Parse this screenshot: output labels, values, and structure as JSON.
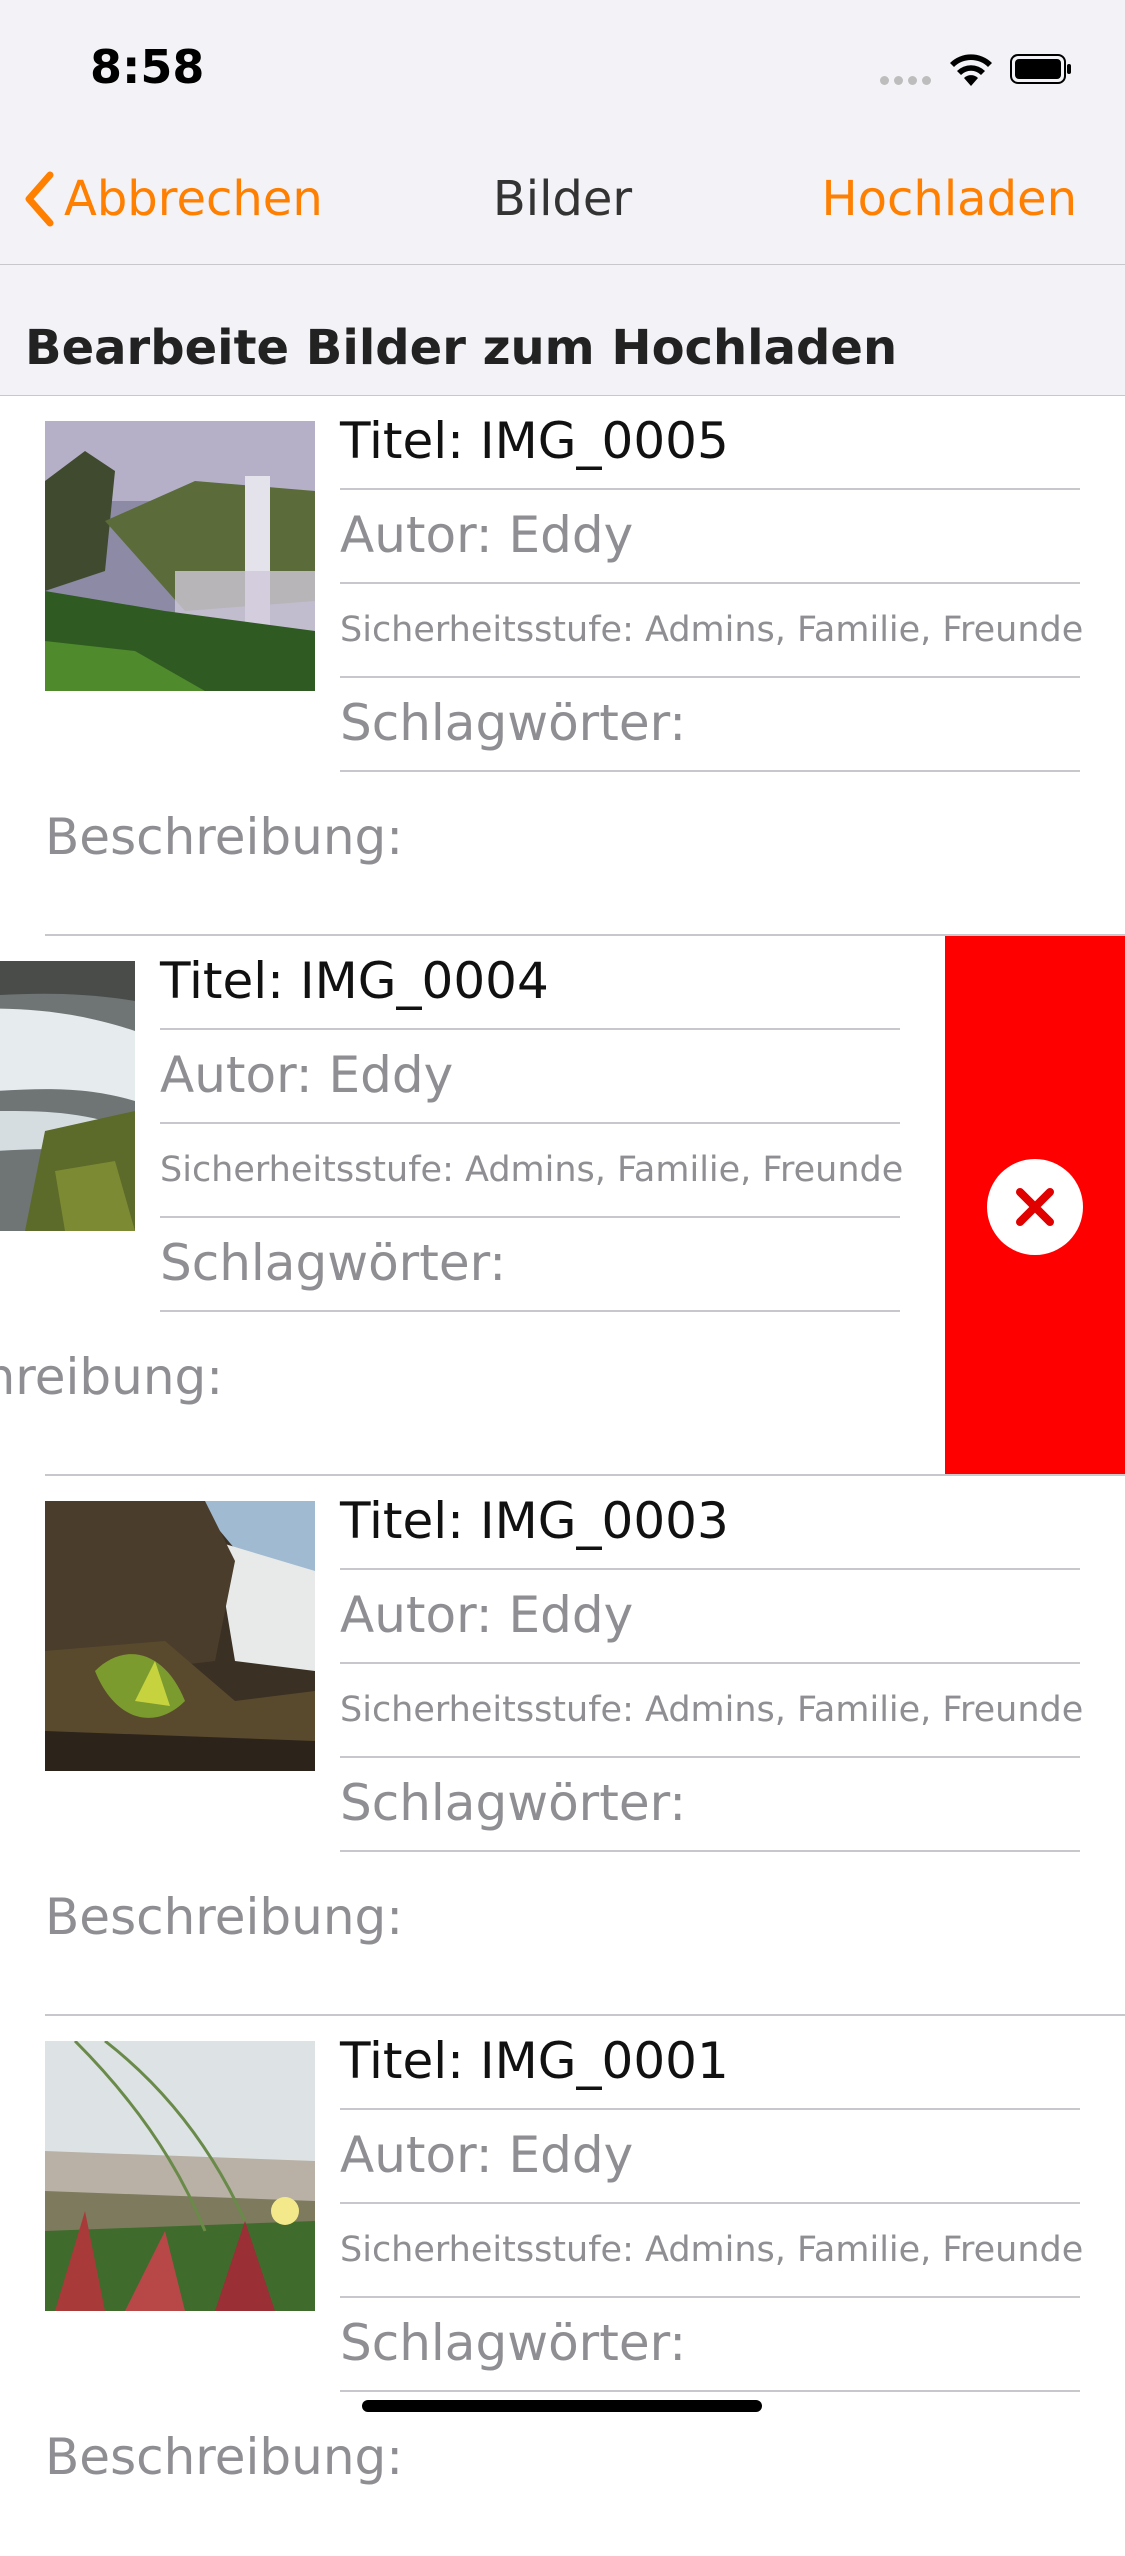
{
  "status_bar": {
    "time": "8:58"
  },
  "nav": {
    "cancel_label": "Abbrechen",
    "title": "Bilder",
    "upload_label": "Hochladen",
    "accent_color": "#ff7f00"
  },
  "section_title": "Bearbeite Bilder zum Hochladen",
  "items": [
    {
      "title": "Titel: IMG_0005",
      "author": "Autor: Eddy",
      "security": "Sicherheitsstufe: Admins, Familie, Freunde",
      "tags": "Schlagwörter:",
      "description": "Beschreibung:",
      "thumbnail": "waterfall-cliff-image"
    },
    {
      "title": "Titel: IMG_0004",
      "author": "Autor: Eddy",
      "security": "Sicherheitsstufe: Admins, Familie, Freunde",
      "tags": "Schlagwörter:",
      "description": "Beschreibung:",
      "thumbnail": "stream-rocks-image",
      "swiped_open": true
    },
    {
      "title": "Titel: IMG_0003",
      "author": "Autor: Eddy",
      "security": "Sicherheitsstufe: Admins, Familie, Freunde",
      "tags": "Schlagwörter:",
      "description": "Beschreibung:",
      "thumbnail": "waterfall-plants-image"
    },
    {
      "title": "Titel: IMG_0001",
      "author": "Autor: Eddy",
      "security": "Sicherheitsstufe: Admins, Familie, Freunde",
      "tags": "Schlagwörter:",
      "description": "Beschreibung:",
      "thumbnail": "dune-grass-image"
    }
  ],
  "delete_action": {
    "icon": "close-icon",
    "color": "#ff0000"
  }
}
